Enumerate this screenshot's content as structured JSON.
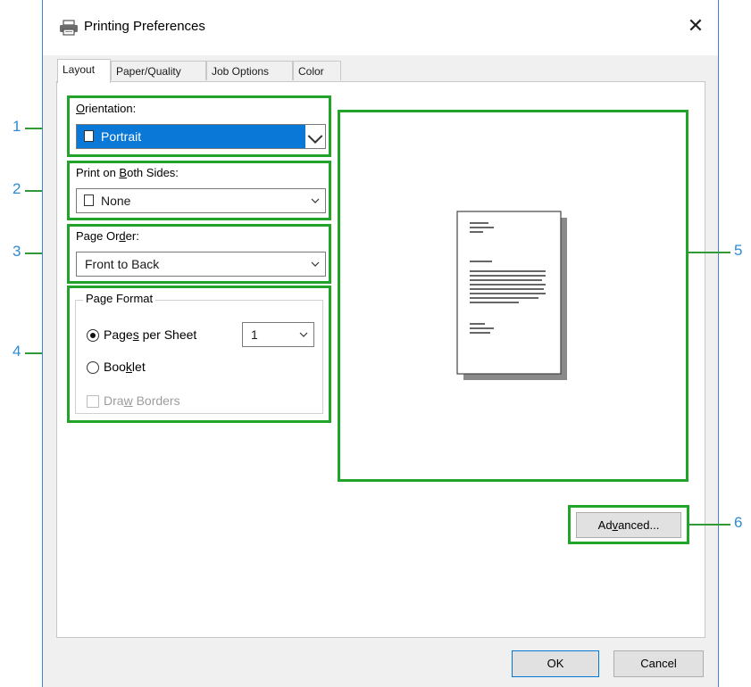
{
  "window": {
    "title": "Printing Preferences",
    "close_symbol": "✕"
  },
  "tabs": [
    {
      "label": "Layout"
    },
    {
      "label": "Paper/Quality"
    },
    {
      "label": "Job Options"
    },
    {
      "label": "Color"
    }
  ],
  "orientation": {
    "label_first": "O",
    "label_rest": "rientation:",
    "value": "Portrait"
  },
  "duplex": {
    "label_pre": "Print on ",
    "label_key": "B",
    "label_post": "oth Sides:",
    "value": "None"
  },
  "page_order": {
    "label_pre": "Page Or",
    "label_key": "d",
    "label_post": "er:",
    "value": "Front to Back"
  },
  "page_format": {
    "title": "Page Format",
    "pages_per_sheet": {
      "label_pre": "Page",
      "label_key": "s",
      "label_post": " per Sheet",
      "checked": true,
      "value": "1"
    },
    "booklet": {
      "label_pre": "Boo",
      "label_key": "k",
      "label_post": "let",
      "checked": false
    },
    "draw_borders": {
      "label_pre": "Dra",
      "label_key": "w",
      "label_post": " Borders",
      "checked": false,
      "enabled": false
    }
  },
  "buttons": {
    "advanced": {
      "pre": "Ad",
      "key": "v",
      "post": "anced..."
    },
    "ok": "OK",
    "cancel": "Cancel"
  },
  "callouts": [
    "1",
    "2",
    "3",
    "4",
    "5",
    "6"
  ],
  "colors": {
    "callout_box": "#22a32a",
    "callout_number": "#2e8bd6",
    "selection": "#0a78d7"
  }
}
